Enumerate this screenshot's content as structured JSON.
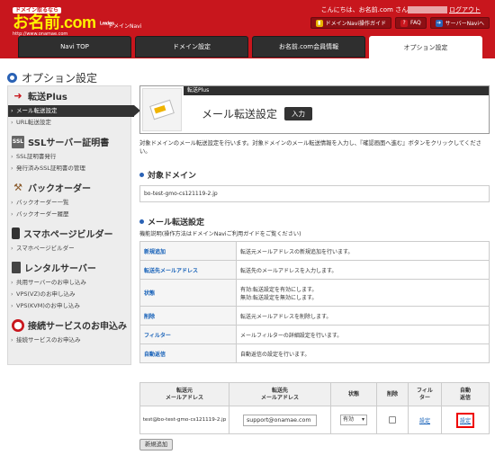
{
  "header": {
    "logo_tag": "ドメイン取るなら",
    "logo_brand": "お名前.com",
    "logo_suffix": "Leaders",
    "logo_url": "http://www.onamae.com",
    "sub_brand": "ドメインNavi",
    "greeting_prefix": "こんにちは、お名前.com さん",
    "greeting_user": "■■■■■■",
    "logout": "ログアウト",
    "buttons": [
      {
        "label": "ドメインNavi操作ガイド",
        "icon": "guide-icon"
      },
      {
        "label": "FAQ",
        "icon": "question-icon"
      },
      {
        "label": "サーバーNaviへ",
        "icon": "arrow-icon"
      }
    ],
    "tabs": [
      "Navi TOP",
      "ドメイン設定",
      "お名前.com会員情報",
      "オプション設定"
    ],
    "active_tab": 3
  },
  "page_title": "オプション設定",
  "sidebar": {
    "sections": [
      {
        "title": "転送Plus",
        "icon": "arrow-icon",
        "items": [
          "メール転送設定",
          "URL転送設定"
        ]
      },
      {
        "title": "SSLサーバー証明書",
        "icon": "ssl-icon",
        "items": [
          "SSL証明書発行",
          "発行済みSSL証明書の管理"
        ]
      },
      {
        "title": "バックオーダー",
        "icon": "hammer-icon",
        "items": [
          "バックオーダー一覧",
          "バックオーダー履歴"
        ]
      },
      {
        "title": "スマホページビルダー",
        "icon": "smartphone-icon",
        "items": [
          "スマホページビルダー"
        ]
      },
      {
        "title": "レンタルサーバー",
        "icon": "server-icon",
        "items": [
          "共用サーバーのお申し込み",
          "VPS(VZ)のお申し込み",
          "VPS(KVM)のお申し込み"
        ]
      },
      {
        "title": "接続サービスのお申込み",
        "icon": "network-icon",
        "items": [
          "接続サービスのお申込み"
        ]
      }
    ],
    "active_item": "メール転送設定"
  },
  "hero": {
    "category": "転送Plus",
    "title": "メール転送設定",
    "badge": "入力"
  },
  "intro": "対象ドメインのメール転送設定を行います。対象ドメインのメール転送情報を入力し、『確認画面へ進む』ボタンをクリックしてください。",
  "target": {
    "heading": "対象ドメイン",
    "domain": "bo-test-gmo-cs121119-2.jp"
  },
  "mail": {
    "heading": "メール転送設定",
    "description": "機能説明(操作方法はドメインNaviご利用ガイドをご覧ください)",
    "rows": [
      {
        "key": "新規追加",
        "value": "転送元メールアドレスの新規追加を行います。"
      },
      {
        "key": "転送先メールアドレス",
        "value": "転送先のメールアドレスを入力します。"
      },
      {
        "key": "状態",
        "value": "有効:転送設定を有効にします。",
        "value2": "無効:転送設定を無効にします。"
      },
      {
        "key": "削除",
        "value": "転送元メールアドレスを削除します。"
      },
      {
        "key": "フィルター",
        "value": "メールフィルターの詳細設定を行います。"
      },
      {
        "key": "自動返信",
        "value": "自動返信の設定を行います。"
      }
    ]
  },
  "form": {
    "headers": [
      "転送元\nメールアドレス",
      "転送先\nメールアドレス",
      "状態",
      "削除",
      "フィル\nター",
      "自動\n返信"
    ],
    "row": {
      "source": "test@bo-test-gmo-cs121119-2.jp",
      "destination": "support@onamae.com",
      "status": "有効",
      "filter_link": "設定",
      "autoreply_link": "設定"
    },
    "new_button": "新規追加"
  },
  "colors": {
    "brand_red": "#c8161d",
    "accent_blue": "#2a62b5",
    "link_blue": "#1560b8",
    "highlight_red": "#ee0000"
  }
}
